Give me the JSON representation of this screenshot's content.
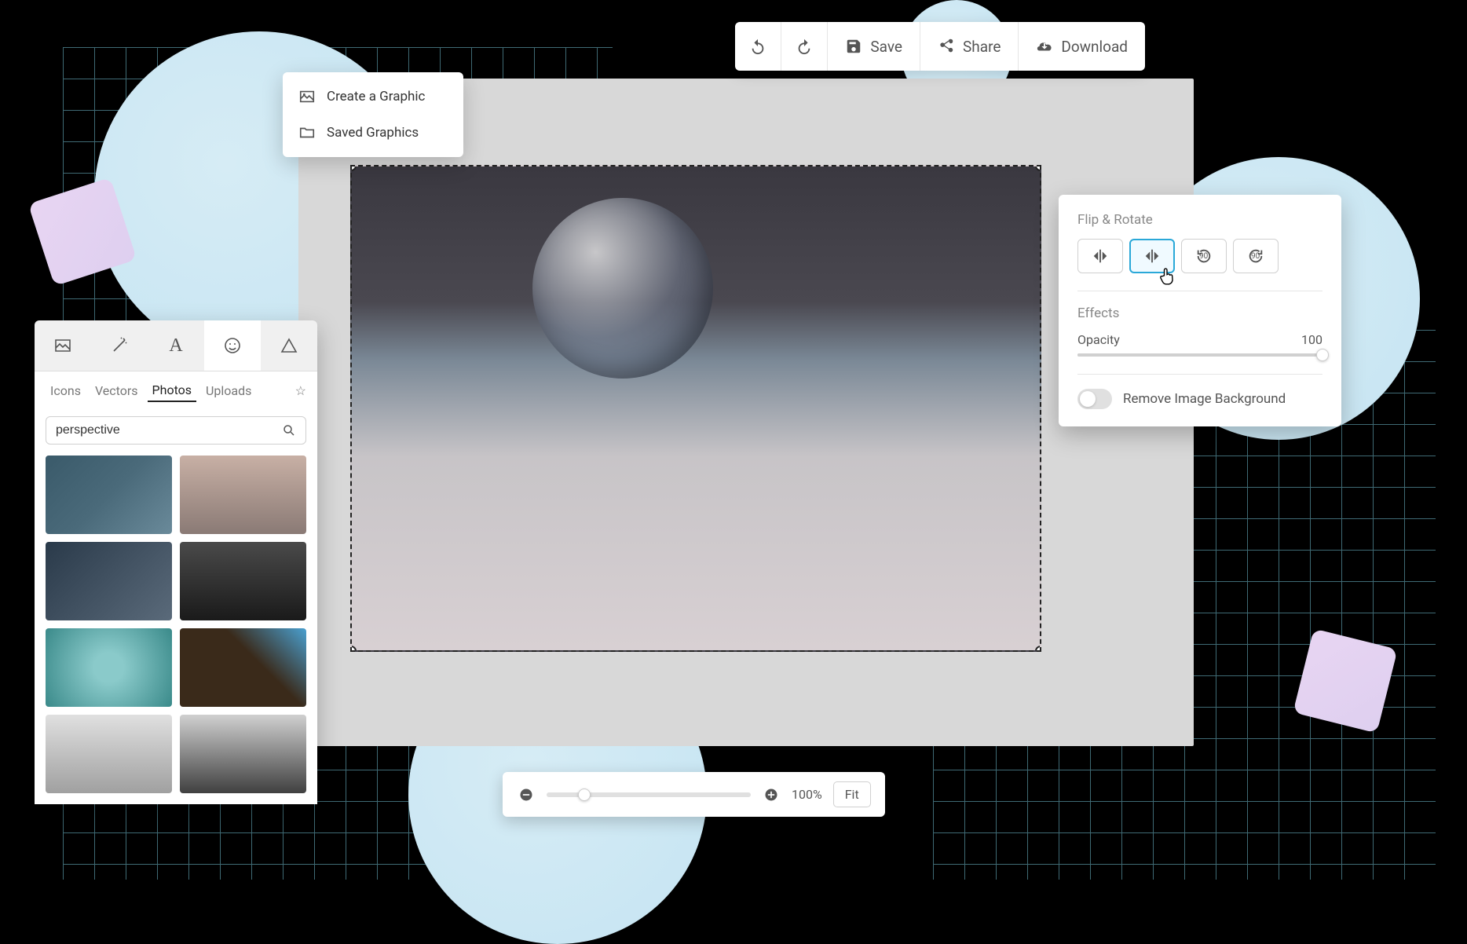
{
  "toolbar": {
    "undo": "Undo",
    "redo": "Redo",
    "save": "Save",
    "share": "Share",
    "download": "Download"
  },
  "menu": {
    "create": "Create a Graphic",
    "saved": "Saved Graphics"
  },
  "assets": {
    "subtabs": {
      "icons": "Icons",
      "vectors": "Vectors",
      "photos": "Photos",
      "uploads": "Uploads"
    },
    "search_value": "perspective",
    "search_placeholder": "Search"
  },
  "props": {
    "flip_title": "Flip & Rotate",
    "rotate_left_deg": "90",
    "rotate_right_deg": "90",
    "effects_title": "Effects",
    "opacity_label": "Opacity",
    "opacity_value": "100",
    "remove_bg": "Remove Image Background"
  },
  "zoom": {
    "value": "100%",
    "fit": "Fit"
  }
}
